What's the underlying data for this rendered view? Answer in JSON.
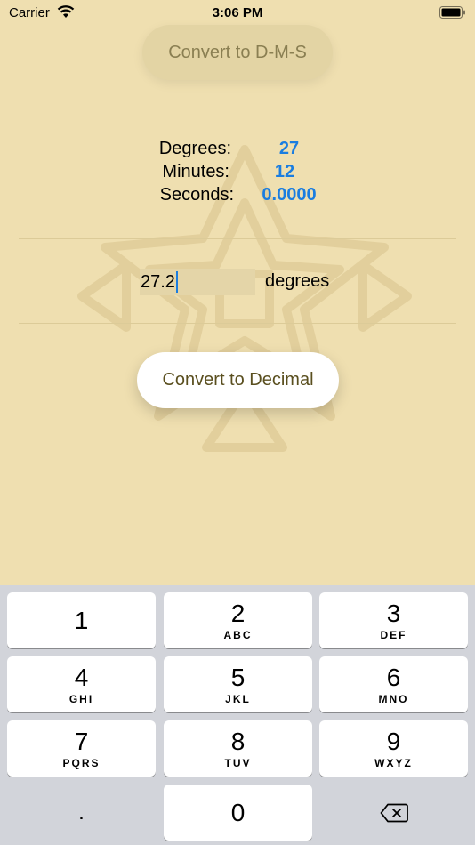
{
  "status_bar": {
    "carrier": "Carrier",
    "time": "3:06 PM"
  },
  "top_button": {
    "label": "Convert to D-M-S"
  },
  "dms": {
    "degrees_label": "Degrees:",
    "degrees_value": "27",
    "minutes_label": "Minutes:",
    "minutes_value": "12",
    "seconds_label": "Seconds:",
    "seconds_value": "0.0000"
  },
  "decimal_input": {
    "value": "27.2",
    "unit_label": "degrees"
  },
  "bottom_button": {
    "label": "Convert to Decimal"
  },
  "keyboard": {
    "keys": [
      {
        "digit": "1",
        "letters": ""
      },
      {
        "digit": "2",
        "letters": "ABC"
      },
      {
        "digit": "3",
        "letters": "DEF"
      },
      {
        "digit": "4",
        "letters": "GHI"
      },
      {
        "digit": "5",
        "letters": "JKL"
      },
      {
        "digit": "6",
        "letters": "MNO"
      },
      {
        "digit": "7",
        "letters": "PQRS"
      },
      {
        "digit": "8",
        "letters": "TUV"
      },
      {
        "digit": "9",
        "letters": "WXYZ"
      },
      {
        "digit": "0",
        "letters": ""
      }
    ],
    "decimal_key": ".",
    "delete_icon": "delete-backward-icon"
  },
  "colors": {
    "background": "#efdfb0",
    "accent_blue": "#1a7de0",
    "button_text": "#5a4f1f"
  }
}
